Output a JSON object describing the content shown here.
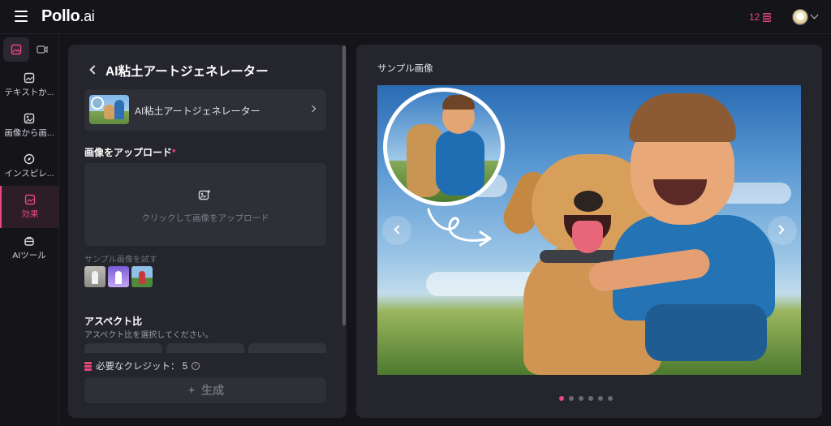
{
  "header": {
    "logo_main": "Pollo",
    "logo_suffix": ".ai",
    "credits": "12"
  },
  "sidebar": {
    "items": [
      {
        "label": "テキストか..."
      },
      {
        "label": "画像から画..."
      },
      {
        "label": "インスピレ..."
      },
      {
        "label": "効果"
      },
      {
        "label": "AIツール"
      }
    ]
  },
  "panel": {
    "title": "AI粘土アートジェネレーター",
    "tool_name": "AI粘土アートジェネレーター",
    "upload_label": "画像をアップロード",
    "required_mark": "*",
    "upload_hint": "クリックして画像をアップロード",
    "sample_label": "サンプル画像を試す",
    "aspect_title": "アスペクト比",
    "aspect_sub": "アスペクト比を選択してください。",
    "credits_needed": "必要なクレジット： 5",
    "info_glyph": "i",
    "generate_label": "生成"
  },
  "preview": {
    "title": "サンプル画像",
    "slide_count": 6,
    "active_slide": 1
  },
  "colors": {
    "accent": "#e8487a",
    "background": "#141419",
    "panel": "#25252d"
  }
}
